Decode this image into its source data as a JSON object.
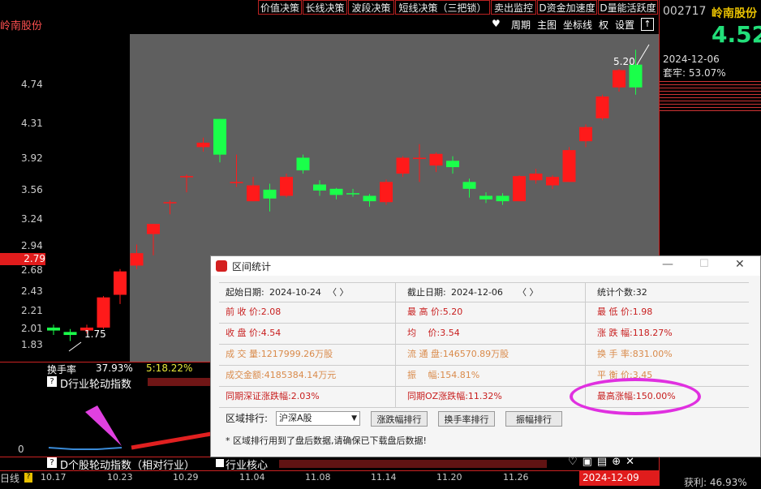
{
  "stock": {
    "name": "岭南股份",
    "code": "002717",
    "price": "4.52",
    "date": "2024-12-06",
    "trapped": "套牢: 53.07%"
  },
  "top_menu": [
    "价值决策",
    "长线决策",
    "波段决策",
    "短线决策（三把锁）",
    "卖出监控",
    "D资金加速度",
    "D量能活跃度"
  ],
  "toolbar": {
    "period": "周期",
    "main_chart": "主图",
    "coordinate": "坐标线",
    "rights": "权",
    "settings": "设置"
  },
  "y_ticks": [
    "4.74",
    "4.31",
    "3.92",
    "3.56",
    "3.24",
    "2.94",
    "2.68",
    "2.43",
    "2.21",
    "2.01",
    "1.83"
  ],
  "price_marker": "2.79",
  "annotations": {
    "high": "5.20",
    "low": "1.75"
  },
  "turnover": {
    "label": "换手率",
    "value": "37.93%",
    "ma": "5:18.22%"
  },
  "indicator1": {
    "label": "D行业轮动指数",
    "hint": "?"
  },
  "indicator2": {
    "label": "D个股轮动指数（相对行业）",
    "checkbox": "行业核心",
    "zero": "0"
  },
  "x_dates": [
    "10.17",
    "10.23",
    "10.29",
    "11.04",
    "11.08",
    "11.14",
    "11.20",
    "11.26"
  ],
  "bottom": {
    "mode": "日线",
    "date_badge": "2024-12-09",
    "profit": "获利: 46.93%"
  },
  "chart_data": {
    "type": "candlestick",
    "ylim": [
      1.7,
      5.3
    ],
    "candles": [
      {
        "o": 1.85,
        "c": 1.83,
        "h": 1.87,
        "l": 1.8
      },
      {
        "o": 1.82,
        "c": 1.8,
        "h": 1.84,
        "l": 1.76
      },
      {
        "o": 1.83,
        "c": 1.85,
        "h": 1.87,
        "l": 1.81
      },
      {
        "o": 1.85,
        "c": 2.07,
        "h": 2.08,
        "l": 1.84
      },
      {
        "o": 2.09,
        "c": 2.28,
        "h": 2.3,
        "l": 2.02
      },
      {
        "o": 2.33,
        "c": 2.44,
        "h": 2.52,
        "l": 2.3
      },
      {
        "o": 2.62,
        "c": 2.72,
        "h": 2.72,
        "l": 2.42
      },
      {
        "o": 2.95,
        "c": 2.95,
        "h": 2.97,
        "l": 2.82
      },
      {
        "o": 3.25,
        "c": 3.25,
        "h": 3.27,
        "l": 3.06
      },
      {
        "o": 3.62,
        "c": 3.68,
        "h": 3.75,
        "l": 3.56
      },
      {
        "o": 4.02,
        "c": 3.52,
        "h": 4.02,
        "l": 3.42
      },
      {
        "o": 3.18,
        "c": 3.18,
        "h": 3.52,
        "l": 3.12
      },
      {
        "o": 2.96,
        "c": 3.14,
        "h": 3.24,
        "l": 2.96
      },
      {
        "o": 3.09,
        "c": 2.99,
        "h": 3.16,
        "l": 2.85
      },
      {
        "o": 3.02,
        "c": 3.24,
        "h": 3.28,
        "l": 3.0
      },
      {
        "o": 3.48,
        "c": 3.32,
        "h": 3.52,
        "l": 3.28
      },
      {
        "o": 3.15,
        "c": 3.08,
        "h": 3.2,
        "l": 3.02
      },
      {
        "o": 3.1,
        "c": 3.03,
        "h": 3.11,
        "l": 2.98
      },
      {
        "o": 3.05,
        "c": 3.04,
        "h": 3.1,
        "l": 3.01
      },
      {
        "o": 3.02,
        "c": 2.96,
        "h": 3.04,
        "l": 2.9
      },
      {
        "o": 2.95,
        "c": 3.18,
        "h": 3.21,
        "l": 2.92
      },
      {
        "o": 3.28,
        "c": 3.48,
        "h": 3.5,
        "l": 3.24
      },
      {
        "o": 3.48,
        "c": 3.48,
        "h": 3.66,
        "l": 3.18
      },
      {
        "o": 3.38,
        "c": 3.53,
        "h": 3.55,
        "l": 3.3
      },
      {
        "o": 3.44,
        "c": 3.36,
        "h": 3.5,
        "l": 3.28
      },
      {
        "o": 3.18,
        "c": 3.1,
        "h": 3.22,
        "l": 3.0
      },
      {
        "o": 3.02,
        "c": 2.98,
        "h": 3.06,
        "l": 2.94
      },
      {
        "o": 3.02,
        "c": 2.96,
        "h": 3.05,
        "l": 2.92
      },
      {
        "o": 2.96,
        "c": 3.25,
        "h": 3.26,
        "l": 2.96
      },
      {
        "o": 3.2,
        "c": 3.28,
        "h": 3.34,
        "l": 3.16
      },
      {
        "o": 3.14,
        "c": 3.24,
        "h": 3.26,
        "l": 3.1
      },
      {
        "o": 3.18,
        "c": 3.58,
        "h": 3.62,
        "l": 3.18
      },
      {
        "o": 3.7,
        "c": 3.9,
        "h": 3.94,
        "l": 3.62
      },
      {
        "o": 4.03,
        "c": 4.37,
        "h": 4.4,
        "l": 4.0
      },
      {
        "o": 4.52,
        "c": 4.82,
        "h": 4.84,
        "l": 4.45
      },
      {
        "o": 4.92,
        "c": 4.52,
        "h": 5.2,
        "l": 4.4
      }
    ]
  },
  "dialog": {
    "title": "区间统计",
    "start_label": "起始日期:",
    "start_date": "2024-10-24",
    "end_label": "截止日期:",
    "end_date": "2024-12-06",
    "count": "统计个数:32",
    "prev_close": "前 收 价:2.08",
    "high": "最 高 价:5.20",
    "low": "最 低 价:1.98",
    "close": "收 盘 价:4.54",
    "avg": "均　 价:3.54",
    "change": "涨 跌 幅:118.27%",
    "volume": "成 交 量:1217999.26万股",
    "float": "流 通 盘:146570.89万股",
    "turnover": "换 手 率:831.00%",
    "amount": "成交金额:4185384.14万元",
    "amplitude": "振　  幅:154.81%",
    "avg_turnover": "平 衡 价:3.45",
    "sz_change": "同期深证涨跌幅:2.03%",
    "zz_change": "同期OZ涨跌幅:11.32%",
    "max_rise": "最高涨幅:150.00%",
    "rank_label": "区域排行:",
    "rank_select": "沪深A股",
    "rank_btn1": "涨跌幅排行",
    "rank_btn2": "换手率排行",
    "rank_btn3": "振幅排行",
    "note": "* 区域排行用到了盘后数据,请确保已下载盘后数据!",
    "arrows": "〈 〉"
  }
}
